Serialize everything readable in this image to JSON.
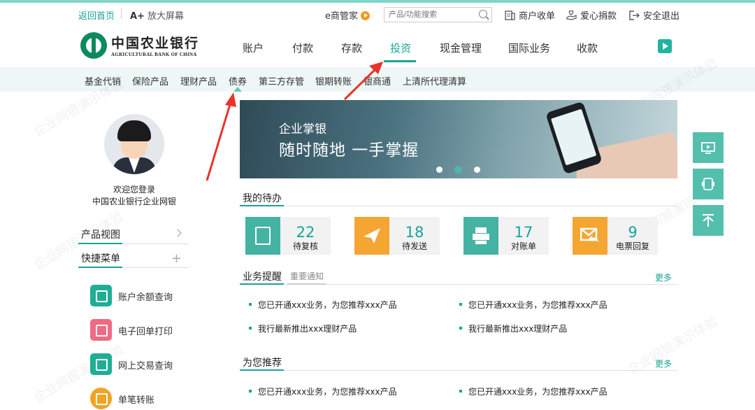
{
  "topbar": {
    "home": "返回首页",
    "zoom_prefix": "A+",
    "zoom": "放大屏幕",
    "ebiz": "e商管家",
    "search_placeholder": "产品/功能搜索",
    "merchant": "商户收单",
    "charity": "爱心捐款",
    "logout": "安全退出"
  },
  "logo": {
    "cn": "中国农业银行",
    "en": "AGRICULTURAL BANK OF CHINA"
  },
  "mainnav": {
    "items": [
      "账户",
      "付款",
      "存款",
      "投资",
      "现金管理",
      "国际业务",
      "收款"
    ],
    "active": "投资"
  },
  "subnav": {
    "items": [
      "基金代销",
      "保险产品",
      "理财产品",
      "债券",
      "第三方存管",
      "银期转账",
      "银商通",
      "上清所代理清算"
    ],
    "active": "债券"
  },
  "user": {
    "welcome": "欢迎您登录",
    "org": "中国农业银行企业网银"
  },
  "sidebar": {
    "product_view": "产品视图",
    "quick_menu": "快捷菜单",
    "quick_items": [
      {
        "label": "账户余额查询",
        "color": "#1fae95"
      },
      {
        "label": "电子回单打印",
        "color": "#ef6a83"
      },
      {
        "label": "网上交易查询",
        "color": "#1fae95"
      },
      {
        "label": "单笔转账",
        "color": "#f3a224"
      }
    ]
  },
  "banner": {
    "line1": "企业掌银",
    "line2": "随时随地  一手掌握",
    "slides": 3,
    "active_slide": 2
  },
  "todo": {
    "title": "我的待办",
    "items": [
      {
        "num": "22",
        "label": "待复核",
        "color": "#45b3a4"
      },
      {
        "num": "18",
        "label": "待发送",
        "color": "#f4a532"
      },
      {
        "num": "17",
        "label": "对账单",
        "color": "#45b3a4"
      },
      {
        "num": "9",
        "label": "电票回复",
        "color": "#f4a532"
      }
    ]
  },
  "reminder": {
    "title": "业务提醒",
    "tab2": "重要通知",
    "more": "更多",
    "items": [
      "您已开通xxx业务，为您推荐xxx产品",
      "您已开通xxx业务，为您推荐xxx产品",
      "我行最新推出xxx理财产品",
      "我行最新推出xxx理财产品"
    ]
  },
  "recommend": {
    "title": "为您推荐",
    "more": "更多",
    "items": [
      "您已开通xxx业务，为您推荐xxx产品",
      "您已开通xxx业务，为您推荐xxx产品"
    ]
  },
  "watermark": "企业网银演示体验",
  "colors": {
    "accent": "#16a596",
    "annotation": "#e9322b"
  }
}
